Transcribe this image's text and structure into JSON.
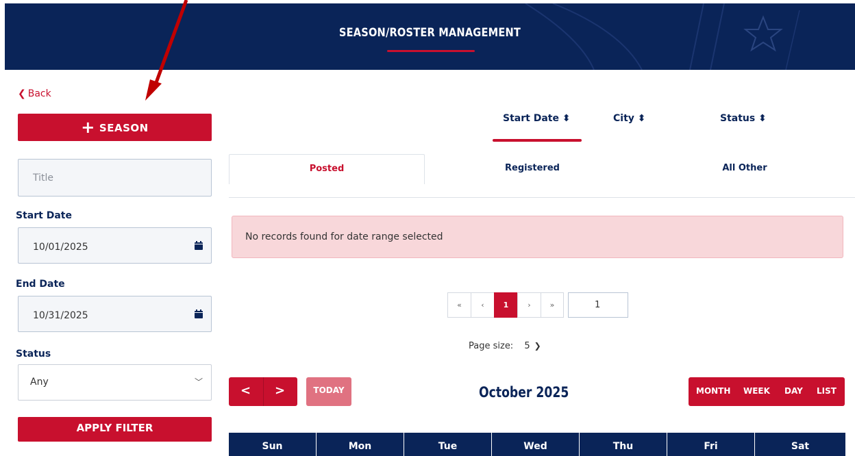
{
  "header": {
    "title": "SEASON/ROSTER MANAGEMENT"
  },
  "sidebar": {
    "back_label": "Back",
    "season_button": "SEASON",
    "title_placeholder": "Title",
    "start_date_label": "Start Date",
    "start_date_value": "10/01/2025",
    "end_date_label": "End Date",
    "end_date_value": "10/31/2025",
    "status_label": "Status",
    "status_value": "Any",
    "apply_button": "APPLY FILTER"
  },
  "sort": {
    "items": [
      {
        "label": "Start Date",
        "active": true
      },
      {
        "label": "City",
        "active": false
      },
      {
        "label": "Status",
        "active": false
      }
    ]
  },
  "tabs": [
    {
      "label": "Posted",
      "active": true
    },
    {
      "label": "Registered",
      "active": false
    },
    {
      "label": "All Other",
      "active": false
    }
  ],
  "alert": {
    "message": "No records found for date range selected"
  },
  "pager": {
    "first": "«",
    "prev": "‹",
    "current": "1",
    "next": "›",
    "last": "»",
    "page_input": "1",
    "page_size_label": "Page size:",
    "page_size_value": "5"
  },
  "calendar": {
    "today": "TODAY",
    "title": "October 2025",
    "views": [
      "MONTH",
      "WEEK",
      "DAY",
      "LIST"
    ],
    "days": [
      "Sun",
      "Mon",
      "Tue",
      "Wed",
      "Thu",
      "Fri",
      "Sat"
    ]
  },
  "colors": {
    "navy": "#0a2458",
    "red": "#c8102e",
    "alert_bg": "#f8d7da"
  },
  "icons": [
    "chevron-left-icon",
    "plus-icon",
    "calendar-icon",
    "chevron-down-icon",
    "sort-icon"
  ]
}
